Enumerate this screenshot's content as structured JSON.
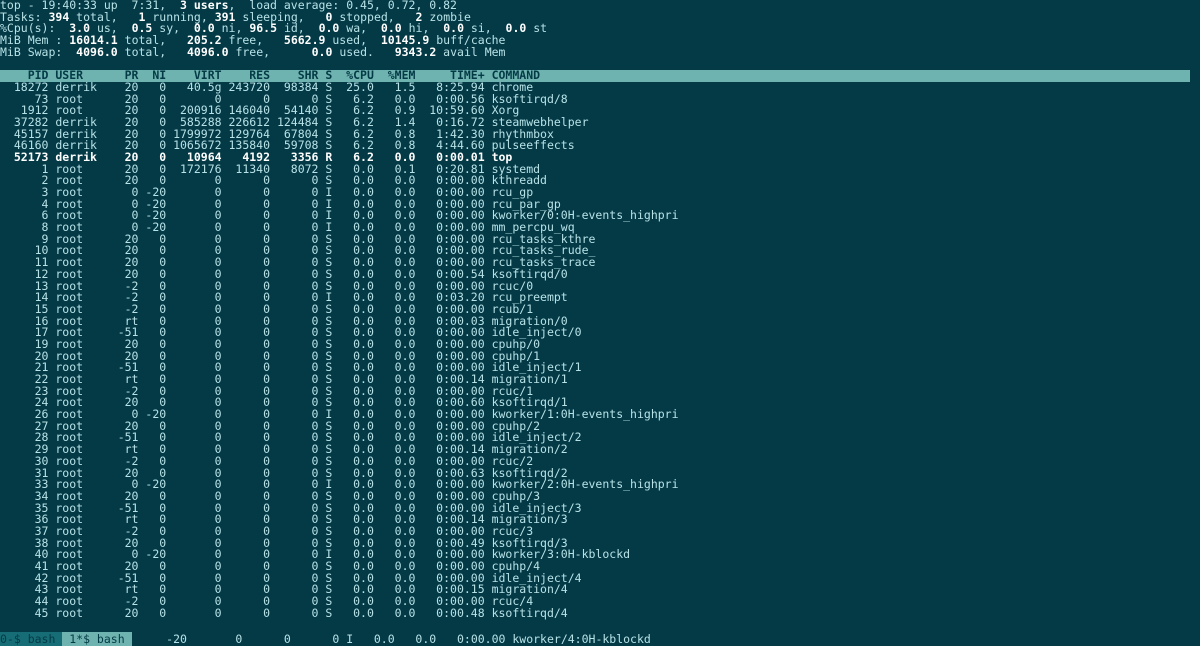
{
  "summary": {
    "line1": {
      "prefix": "top - ",
      "time": "19:40:33",
      "up": " up  7:31,  ",
      "users": "3 users",
      "load_label": ",  load average: ",
      "load": "0.45, 0.72, 0.82"
    },
    "line2": {
      "label": "Tasks: ",
      "total": "394",
      "total_sfx": " total,   ",
      "running": "1",
      "running_sfx": " running, ",
      "sleeping": "391",
      "sleeping_sfx": " sleeping,   ",
      "stopped": "0",
      "stopped_sfx": " stopped,   ",
      "zombie": "2",
      "zombie_sfx": " zombie"
    },
    "line3": {
      "label": "%Cpu(s):  ",
      "us": "3.0",
      "us_sfx": " us,  ",
      "sy": "0.5",
      "sy_sfx": " sy,  ",
      "ni": "0.0",
      "ni_sfx": " ni, ",
      "id": "96.5",
      "id_sfx": " id,  ",
      "wa": "0.0",
      "wa_sfx": " wa,  ",
      "hi": "0.0",
      "hi_sfx": " hi,  ",
      "si": "0.0",
      "si_sfx": " si,  ",
      "st": "0.0",
      "st_sfx": " st"
    },
    "line4": {
      "label": "MiB Mem : ",
      "total": "16014.1",
      "total_sfx": " total,   ",
      "free": "205.2",
      "free_sfx": " free,   ",
      "used": "5662.9",
      "used_sfx": " used,  ",
      "buff": "10145.9",
      "buff_sfx": " buff/cache"
    },
    "line5": {
      "label": "MiB Swap:  ",
      "total": "4096.0",
      "total_sfx": " total,   ",
      "free": "4096.0",
      "free_sfx": " free,      ",
      "used": "0.0",
      "used_sfx": " used.   ",
      "avail": "9343.2",
      "avail_sfx": " avail Mem"
    }
  },
  "header": "    PID USER      PR  NI    VIRT    RES    SHR S  %CPU  %MEM     TIME+ COMMAND",
  "processes": [
    {
      "pid": "18272",
      "user": "derrik",
      "pr": "20",
      "ni": "0",
      "virt": "40.5g",
      "res": "243720",
      "shr": "98384",
      "s": "S",
      "cpu": "25.0",
      "mem": "1.5",
      "time": "8:25.94",
      "cmd": "chrome",
      "hl": false
    },
    {
      "pid": "73",
      "user": "root",
      "pr": "20",
      "ni": "0",
      "virt": "0",
      "res": "0",
      "shr": "0",
      "s": "S",
      "cpu": "6.2",
      "mem": "0.0",
      "time": "0:00.56",
      "cmd": "ksoftirqd/8",
      "hl": false
    },
    {
      "pid": "1912",
      "user": "root",
      "pr": "20",
      "ni": "0",
      "virt": "200916",
      "res": "146040",
      "shr": "54140",
      "s": "S",
      "cpu": "6.2",
      "mem": "0.9",
      "time": "10:59.60",
      "cmd": "Xorg",
      "hl": false
    },
    {
      "pid": "37282",
      "user": "derrik",
      "pr": "20",
      "ni": "0",
      "virt": "585288",
      "res": "226612",
      "shr": "124484",
      "s": "S",
      "cpu": "6.2",
      "mem": "1.4",
      "time": "0:16.72",
      "cmd": "steamwebhelper",
      "hl": false
    },
    {
      "pid": "45157",
      "user": "derrik",
      "pr": "20",
      "ni": "0",
      "virt": "1799972",
      "res": "129764",
      "shr": "67804",
      "s": "S",
      "cpu": "6.2",
      "mem": "0.8",
      "time": "1:42.30",
      "cmd": "rhythmbox",
      "hl": false
    },
    {
      "pid": "46160",
      "user": "derrik",
      "pr": "20",
      "ni": "0",
      "virt": "1065672",
      "res": "135840",
      "shr": "59708",
      "s": "S",
      "cpu": "6.2",
      "mem": "0.8",
      "time": "4:44.60",
      "cmd": "pulseeffects",
      "hl": false
    },
    {
      "pid": "52173",
      "user": "derrik",
      "pr": "20",
      "ni": "0",
      "virt": "10964",
      "res": "4192",
      "shr": "3356",
      "s": "R",
      "cpu": "6.2",
      "mem": "0.0",
      "time": "0:00.01",
      "cmd": "top",
      "hl": true
    },
    {
      "pid": "1",
      "user": "root",
      "pr": "20",
      "ni": "0",
      "virt": "172176",
      "res": "11340",
      "shr": "8072",
      "s": "S",
      "cpu": "0.0",
      "mem": "0.1",
      "time": "0:20.81",
      "cmd": "systemd",
      "hl": false
    },
    {
      "pid": "2",
      "user": "root",
      "pr": "20",
      "ni": "0",
      "virt": "0",
      "res": "0",
      "shr": "0",
      "s": "S",
      "cpu": "0.0",
      "mem": "0.0",
      "time": "0:00.00",
      "cmd": "kthreadd",
      "hl": false
    },
    {
      "pid": "3",
      "user": "root",
      "pr": "0",
      "ni": "-20",
      "virt": "0",
      "res": "0",
      "shr": "0",
      "s": "I",
      "cpu": "0.0",
      "mem": "0.0",
      "time": "0:00.00",
      "cmd": "rcu_gp",
      "hl": false
    },
    {
      "pid": "4",
      "user": "root",
      "pr": "0",
      "ni": "-20",
      "virt": "0",
      "res": "0",
      "shr": "0",
      "s": "I",
      "cpu": "0.0",
      "mem": "0.0",
      "time": "0:00.00",
      "cmd": "rcu_par_gp",
      "hl": false
    },
    {
      "pid": "6",
      "user": "root",
      "pr": "0",
      "ni": "-20",
      "virt": "0",
      "res": "0",
      "shr": "0",
      "s": "I",
      "cpu": "0.0",
      "mem": "0.0",
      "time": "0:00.00",
      "cmd": "kworker/0:0H-events_highpri",
      "hl": false
    },
    {
      "pid": "8",
      "user": "root",
      "pr": "0",
      "ni": "-20",
      "virt": "0",
      "res": "0",
      "shr": "0",
      "s": "I",
      "cpu": "0.0",
      "mem": "0.0",
      "time": "0:00.00",
      "cmd": "mm_percpu_wq",
      "hl": false
    },
    {
      "pid": "9",
      "user": "root",
      "pr": "20",
      "ni": "0",
      "virt": "0",
      "res": "0",
      "shr": "0",
      "s": "S",
      "cpu": "0.0",
      "mem": "0.0",
      "time": "0:00.00",
      "cmd": "rcu_tasks_kthre",
      "hl": false
    },
    {
      "pid": "10",
      "user": "root",
      "pr": "20",
      "ni": "0",
      "virt": "0",
      "res": "0",
      "shr": "0",
      "s": "S",
      "cpu": "0.0",
      "mem": "0.0",
      "time": "0:00.00",
      "cmd": "rcu_tasks_rude_",
      "hl": false
    },
    {
      "pid": "11",
      "user": "root",
      "pr": "20",
      "ni": "0",
      "virt": "0",
      "res": "0",
      "shr": "0",
      "s": "S",
      "cpu": "0.0",
      "mem": "0.0",
      "time": "0:00.00",
      "cmd": "rcu_tasks_trace",
      "hl": false
    },
    {
      "pid": "12",
      "user": "root",
      "pr": "20",
      "ni": "0",
      "virt": "0",
      "res": "0",
      "shr": "0",
      "s": "S",
      "cpu": "0.0",
      "mem": "0.0",
      "time": "0:00.54",
      "cmd": "ksoftirqd/0",
      "hl": false
    },
    {
      "pid": "13",
      "user": "root",
      "pr": "-2",
      "ni": "0",
      "virt": "0",
      "res": "0",
      "shr": "0",
      "s": "S",
      "cpu": "0.0",
      "mem": "0.0",
      "time": "0:00.00",
      "cmd": "rcuc/0",
      "hl": false
    },
    {
      "pid": "14",
      "user": "root",
      "pr": "-2",
      "ni": "0",
      "virt": "0",
      "res": "0",
      "shr": "0",
      "s": "I",
      "cpu": "0.0",
      "mem": "0.0",
      "time": "0:03.20",
      "cmd": "rcu_preempt",
      "hl": false
    },
    {
      "pid": "15",
      "user": "root",
      "pr": "-2",
      "ni": "0",
      "virt": "0",
      "res": "0",
      "shr": "0",
      "s": "S",
      "cpu": "0.0",
      "mem": "0.0",
      "time": "0:00.00",
      "cmd": "rcub/1",
      "hl": false
    },
    {
      "pid": "16",
      "user": "root",
      "pr": "rt",
      "ni": "0",
      "virt": "0",
      "res": "0",
      "shr": "0",
      "s": "S",
      "cpu": "0.0",
      "mem": "0.0",
      "time": "0:00.03",
      "cmd": "migration/0",
      "hl": false
    },
    {
      "pid": "17",
      "user": "root",
      "pr": "-51",
      "ni": "0",
      "virt": "0",
      "res": "0",
      "shr": "0",
      "s": "S",
      "cpu": "0.0",
      "mem": "0.0",
      "time": "0:00.00",
      "cmd": "idle_inject/0",
      "hl": false
    },
    {
      "pid": "19",
      "user": "root",
      "pr": "20",
      "ni": "0",
      "virt": "0",
      "res": "0",
      "shr": "0",
      "s": "S",
      "cpu": "0.0",
      "mem": "0.0",
      "time": "0:00.00",
      "cmd": "cpuhp/0",
      "hl": false
    },
    {
      "pid": "20",
      "user": "root",
      "pr": "20",
      "ni": "0",
      "virt": "0",
      "res": "0",
      "shr": "0",
      "s": "S",
      "cpu": "0.0",
      "mem": "0.0",
      "time": "0:00.00",
      "cmd": "cpuhp/1",
      "hl": false
    },
    {
      "pid": "21",
      "user": "root",
      "pr": "-51",
      "ni": "0",
      "virt": "0",
      "res": "0",
      "shr": "0",
      "s": "S",
      "cpu": "0.0",
      "mem": "0.0",
      "time": "0:00.00",
      "cmd": "idle_inject/1",
      "hl": false
    },
    {
      "pid": "22",
      "user": "root",
      "pr": "rt",
      "ni": "0",
      "virt": "0",
      "res": "0",
      "shr": "0",
      "s": "S",
      "cpu": "0.0",
      "mem": "0.0",
      "time": "0:00.14",
      "cmd": "migration/1",
      "hl": false
    },
    {
      "pid": "23",
      "user": "root",
      "pr": "-2",
      "ni": "0",
      "virt": "0",
      "res": "0",
      "shr": "0",
      "s": "S",
      "cpu": "0.0",
      "mem": "0.0",
      "time": "0:00.00",
      "cmd": "rcuc/1",
      "hl": false
    },
    {
      "pid": "24",
      "user": "root",
      "pr": "20",
      "ni": "0",
      "virt": "0",
      "res": "0",
      "shr": "0",
      "s": "S",
      "cpu": "0.0",
      "mem": "0.0",
      "time": "0:00.60",
      "cmd": "ksoftirqd/1",
      "hl": false
    },
    {
      "pid": "26",
      "user": "root",
      "pr": "0",
      "ni": "-20",
      "virt": "0",
      "res": "0",
      "shr": "0",
      "s": "I",
      "cpu": "0.0",
      "mem": "0.0",
      "time": "0:00.00",
      "cmd": "kworker/1:0H-events_highpri",
      "hl": false
    },
    {
      "pid": "27",
      "user": "root",
      "pr": "20",
      "ni": "0",
      "virt": "0",
      "res": "0",
      "shr": "0",
      "s": "S",
      "cpu": "0.0",
      "mem": "0.0",
      "time": "0:00.00",
      "cmd": "cpuhp/2",
      "hl": false
    },
    {
      "pid": "28",
      "user": "root",
      "pr": "-51",
      "ni": "0",
      "virt": "0",
      "res": "0",
      "shr": "0",
      "s": "S",
      "cpu": "0.0",
      "mem": "0.0",
      "time": "0:00.00",
      "cmd": "idle_inject/2",
      "hl": false
    },
    {
      "pid": "29",
      "user": "root",
      "pr": "rt",
      "ni": "0",
      "virt": "0",
      "res": "0",
      "shr": "0",
      "s": "S",
      "cpu": "0.0",
      "mem": "0.0",
      "time": "0:00.14",
      "cmd": "migration/2",
      "hl": false
    },
    {
      "pid": "30",
      "user": "root",
      "pr": "-2",
      "ni": "0",
      "virt": "0",
      "res": "0",
      "shr": "0",
      "s": "S",
      "cpu": "0.0",
      "mem": "0.0",
      "time": "0:00.00",
      "cmd": "rcuc/2",
      "hl": false
    },
    {
      "pid": "31",
      "user": "root",
      "pr": "20",
      "ni": "0",
      "virt": "0",
      "res": "0",
      "shr": "0",
      "s": "S",
      "cpu": "0.0",
      "mem": "0.0",
      "time": "0:00.63",
      "cmd": "ksoftirqd/2",
      "hl": false
    },
    {
      "pid": "33",
      "user": "root",
      "pr": "0",
      "ni": "-20",
      "virt": "0",
      "res": "0",
      "shr": "0",
      "s": "I",
      "cpu": "0.0",
      "mem": "0.0",
      "time": "0:00.00",
      "cmd": "kworker/2:0H-events_highpri",
      "hl": false
    },
    {
      "pid": "34",
      "user": "root",
      "pr": "20",
      "ni": "0",
      "virt": "0",
      "res": "0",
      "shr": "0",
      "s": "S",
      "cpu": "0.0",
      "mem": "0.0",
      "time": "0:00.00",
      "cmd": "cpuhp/3",
      "hl": false
    },
    {
      "pid": "35",
      "user": "root",
      "pr": "-51",
      "ni": "0",
      "virt": "0",
      "res": "0",
      "shr": "0",
      "s": "S",
      "cpu": "0.0",
      "mem": "0.0",
      "time": "0:00.00",
      "cmd": "idle_inject/3",
      "hl": false
    },
    {
      "pid": "36",
      "user": "root",
      "pr": "rt",
      "ni": "0",
      "virt": "0",
      "res": "0",
      "shr": "0",
      "s": "S",
      "cpu": "0.0",
      "mem": "0.0",
      "time": "0:00.14",
      "cmd": "migration/3",
      "hl": false
    },
    {
      "pid": "37",
      "user": "root",
      "pr": "-2",
      "ni": "0",
      "virt": "0",
      "res": "0",
      "shr": "0",
      "s": "S",
      "cpu": "0.0",
      "mem": "0.0",
      "time": "0:00.00",
      "cmd": "rcuc/3",
      "hl": false
    },
    {
      "pid": "38",
      "user": "root",
      "pr": "20",
      "ni": "0",
      "virt": "0",
      "res": "0",
      "shr": "0",
      "s": "S",
      "cpu": "0.0",
      "mem": "0.0",
      "time": "0:00.49",
      "cmd": "ksoftirqd/3",
      "hl": false
    },
    {
      "pid": "40",
      "user": "root",
      "pr": "0",
      "ni": "-20",
      "virt": "0",
      "res": "0",
      "shr": "0",
      "s": "I",
      "cpu": "0.0",
      "mem": "0.0",
      "time": "0:00.00",
      "cmd": "kworker/3:0H-kblockd",
      "hl": false
    },
    {
      "pid": "41",
      "user": "root",
      "pr": "20",
      "ni": "0",
      "virt": "0",
      "res": "0",
      "shr": "0",
      "s": "S",
      "cpu": "0.0",
      "mem": "0.0",
      "time": "0:00.00",
      "cmd": "cpuhp/4",
      "hl": false
    },
    {
      "pid": "42",
      "user": "root",
      "pr": "-51",
      "ni": "0",
      "virt": "0",
      "res": "0",
      "shr": "0",
      "s": "S",
      "cpu": "0.0",
      "mem": "0.0",
      "time": "0:00.00",
      "cmd": "idle_inject/4",
      "hl": false
    },
    {
      "pid": "43",
      "user": "root",
      "pr": "rt",
      "ni": "0",
      "virt": "0",
      "res": "0",
      "shr": "0",
      "s": "S",
      "cpu": "0.0",
      "mem": "0.0",
      "time": "0:00.15",
      "cmd": "migration/4",
      "hl": false
    },
    {
      "pid": "44",
      "user": "root",
      "pr": "-2",
      "ni": "0",
      "virt": "0",
      "res": "0",
      "shr": "0",
      "s": "S",
      "cpu": "0.0",
      "mem": "0.0",
      "time": "0:00.00",
      "cmd": "rcuc/4",
      "hl": false
    },
    {
      "pid": "45",
      "user": "root",
      "pr": "20",
      "ni": "0",
      "virt": "0",
      "res": "0",
      "shr": "0",
      "s": "S",
      "cpu": "0.0",
      "mem": "0.0",
      "time": "0:00.48",
      "cmd": "ksoftirqd/4",
      "hl": false
    }
  ],
  "statusbar": {
    "tab0": "0-$ bash ",
    "tab1": " 1*$ bash ",
    "rest_pr": "",
    "rest_ni": "-20",
    "rest_virt": "0",
    "rest_res": "0",
    "rest_shr": "0",
    "rest_s": "I",
    "rest_cpu": "0.0",
    "rest_mem": "0.0",
    "rest_time": "0:00.00",
    "rest_cmd": "kworker/4:0H-kblockd"
  }
}
